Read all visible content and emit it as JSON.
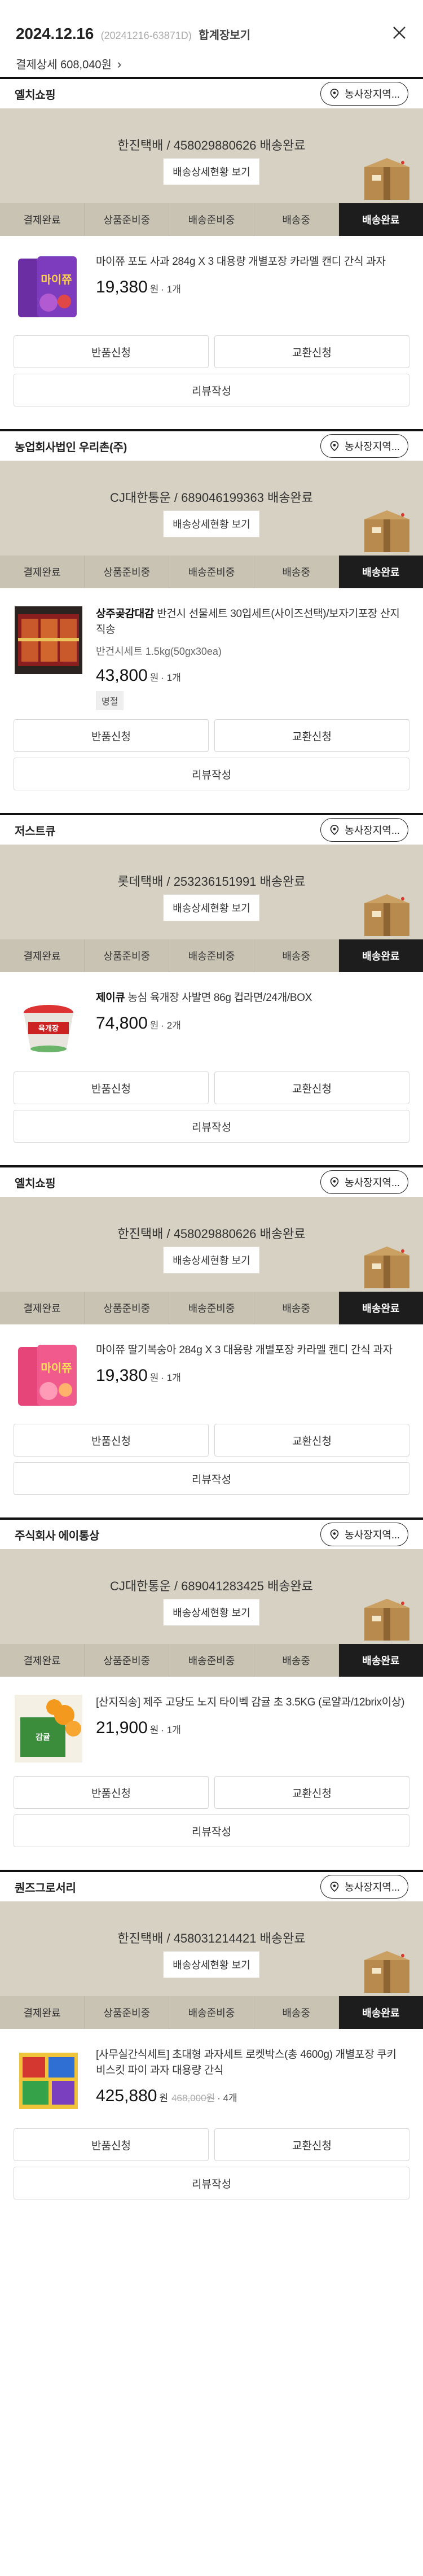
{
  "header": {
    "date": "2024.12.16",
    "order_no": "(20241216-63871D)",
    "merge_label": "합계장보기",
    "payment_summary": "결제상세 608,040원",
    "close_icon": "close-icon"
  },
  "colors": {
    "banner_bg": "#d6d1c3",
    "steps_bg": "#c9c3b3",
    "active_step_bg": "#1d1d1d",
    "divider": "#111111"
  },
  "common": {
    "ask_label": "농사장지역...",
    "detail_button": "배송상세현황 보기",
    "steps": [
      "결제완료",
      "상품준비중",
      "배송준비중",
      "배송중",
      "배송완료"
    ],
    "active_step": 4,
    "return_label": "반품신청",
    "exchange_label": "교환신청",
    "review_label": "리뷰작성"
  },
  "shipments": [
    {
      "seller": "옐치쇼핑",
      "tracking": "한진택배 / 458029880626 배송완료",
      "product": {
        "brand": "",
        "title": "마이쮸 포도 사과 284g X 3 대용량 개별포장 카라멜 캔디 간식 과자",
        "option": "",
        "price": "19,380",
        "won": "원",
        "orig_price": "",
        "qty": "· 1개",
        "tag": "",
        "thumb": "candy-purple"
      }
    },
    {
      "seller": "농업회사법인 우리촌(주)",
      "tracking": "CJ대한통운 / 689046199363 배송완료",
      "product": {
        "brand": "상주곶감대감",
        "title": " 반건시 선물세트 30입세트(사이즈선택)/보자기포장 산지직송",
        "option": "반건시세트 1.5kg(50gx30ea)",
        "price": "43,800",
        "won": "원",
        "orig_price": "",
        "qty": "· 1개",
        "tag": "명절",
        "thumb": "persimmon-gift"
      }
    },
    {
      "seller": "저스트큐",
      "tracking": "롯데택배 / 253236151991 배송완료",
      "product": {
        "brand": "제이큐",
        "title": " 농심 육개장 사발면 86g 컵라면/24개/BOX",
        "option": "",
        "price": "74,800",
        "won": "원",
        "orig_price": "",
        "qty": "· 2개",
        "tag": "",
        "thumb": "cup-noodle"
      }
    },
    {
      "seller": "옐치쇼핑",
      "tracking": "한진택배 / 458029880626 배송완료",
      "product": {
        "brand": "",
        "title": "마이쮸 딸기복숭아 284g X 3 대용량 개별포장 카라멜 캔디 간식 과자",
        "option": "",
        "price": "19,380",
        "won": "원",
        "orig_price": "",
        "qty": "· 1개",
        "tag": "",
        "thumb": "candy-pink"
      }
    },
    {
      "seller": "주식회사 에이통상",
      "tracking": "CJ대한통운 / 689041283425 배송완료",
      "product": {
        "brand": "",
        "title": "[산지직송] 제주 고당도 노지 타이벡 감귤 초 3.5KG (로얄과/12brix이상)",
        "option": "",
        "price": "21,900",
        "won": "원",
        "orig_price": "",
        "qty": "· 1개",
        "tag": "",
        "thumb": "tangerine"
      }
    },
    {
      "seller": "퀀즈그로서리",
      "tracking": "한진택배 / 458031214421 배송완료",
      "product": {
        "brand": "",
        "title": "[사무실간식세트] 초대형 과자세트 로켓박스(총 4600g) 개별포장 쿠키 비스킷 파이 과자 대용량 간식",
        "option": "",
        "price": "425,880",
        "won": "원",
        "orig_price": "468,000원",
        "qty": "· 4개",
        "tag": "",
        "thumb": "snack-box"
      }
    }
  ]
}
